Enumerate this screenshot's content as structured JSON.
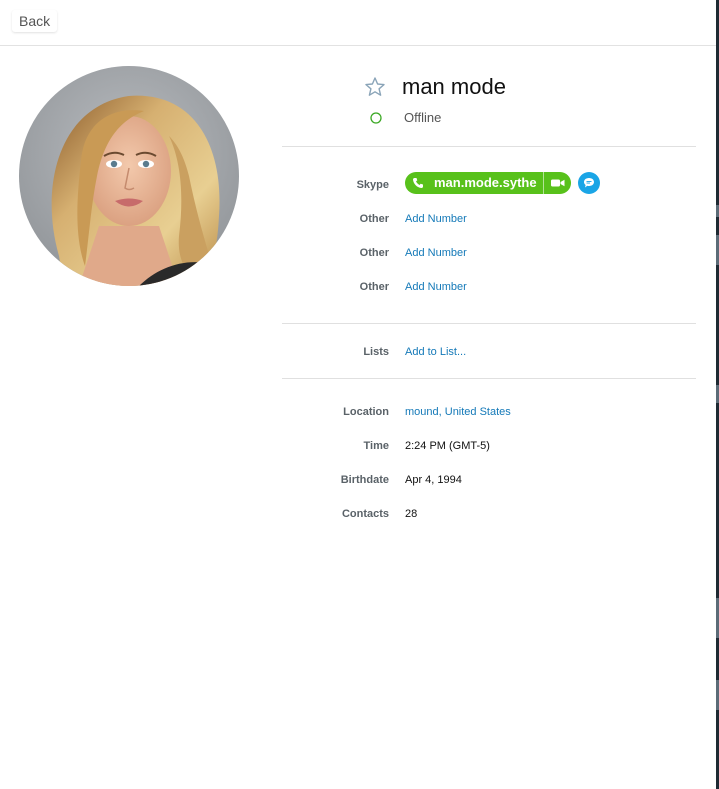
{
  "topbar": {
    "back_label": "Back"
  },
  "profile": {
    "name": "man mode",
    "status": "Offline",
    "status_color": "#3aa823",
    "avatar_icon": "profile-photo"
  },
  "contact": {
    "skype_label": "Skype",
    "skype_handle": "man.mode.sythe",
    "skype_pill_color": "#58c11b",
    "chat_color": "#1aa5e6",
    "numbers": [
      {
        "label": "Other",
        "value": "Add Number"
      },
      {
        "label": "Other",
        "value": "Add Number"
      },
      {
        "label": "Other",
        "value": "Add Number"
      }
    ]
  },
  "lists": {
    "label": "Lists",
    "value": "Add to List..."
  },
  "details": [
    {
      "label": "Location",
      "value": "mound, United States"
    },
    {
      "label": "Time",
      "value": "2:24 PM (GMT-5)"
    },
    {
      "label": "Birthdate",
      "value": "Apr 4, 1994"
    },
    {
      "label": "Contacts",
      "value": "28"
    }
  ],
  "colors": {
    "link": "#1479b8",
    "label": "#5a6268"
  }
}
